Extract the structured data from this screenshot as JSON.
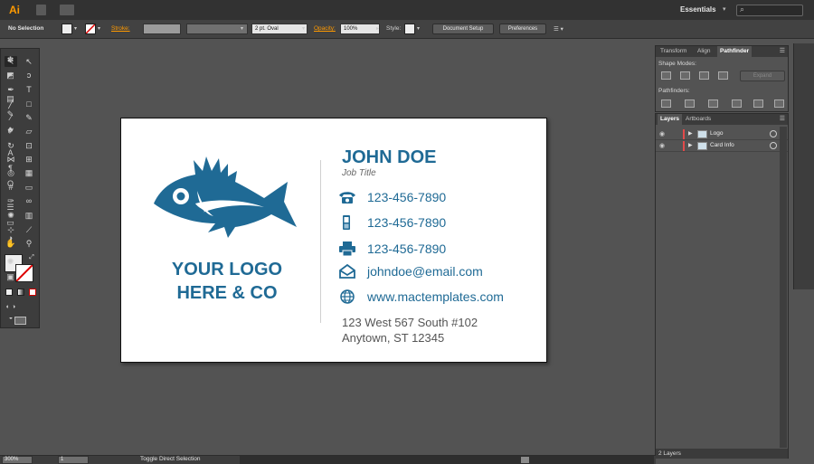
{
  "app": {
    "logo": "Ai",
    "workspace": "Essentials"
  },
  "control_bar": {
    "selection": "No Selection",
    "stroke_label": "Stroke:",
    "brush": "2 pt. Oval",
    "opacity_label": "Opacity:",
    "opacity_value": "100%",
    "style_label": "Style:",
    "document_setup": "Document Setup",
    "preferences": "Preferences"
  },
  "artboard": {
    "logo_text_line1": "YOUR LOGO",
    "logo_text_line2": "HERE & CO",
    "name": "JOHN DOE",
    "job_title": "Job Title",
    "contacts": [
      {
        "icon": "phone-icon",
        "text": "123-456-7890"
      },
      {
        "icon": "mobile-icon",
        "text": "123-456-7890"
      },
      {
        "icon": "fax-icon",
        "text": "123-456-7890"
      },
      {
        "icon": "email-icon",
        "text": "johndoe@email.com"
      },
      {
        "icon": "globe-icon",
        "text": "www.mactemplates.com"
      }
    ],
    "address_line1": "123 West 567 South #102",
    "address_line2": "Anytown, ST 12345",
    "brand_color": "#1f6a95"
  },
  "pathfinder_panel": {
    "tabs": [
      "Transform",
      "Align",
      "Pathfinder"
    ],
    "active_tab": "Pathfinder",
    "shape_modes_label": "Shape Modes:",
    "pathfinders_label": "Pathfinders:",
    "expand_label": "Expand"
  },
  "layers_panel": {
    "tabs": [
      "Layers",
      "Artboards"
    ],
    "active_tab": "Layers",
    "layers": [
      {
        "name": "Logo"
      },
      {
        "name": "Card Info"
      }
    ],
    "count": "2 Layers"
  },
  "status_bar": {
    "zoom": "300%",
    "page": "1",
    "status": "Toggle Direct Selection"
  }
}
